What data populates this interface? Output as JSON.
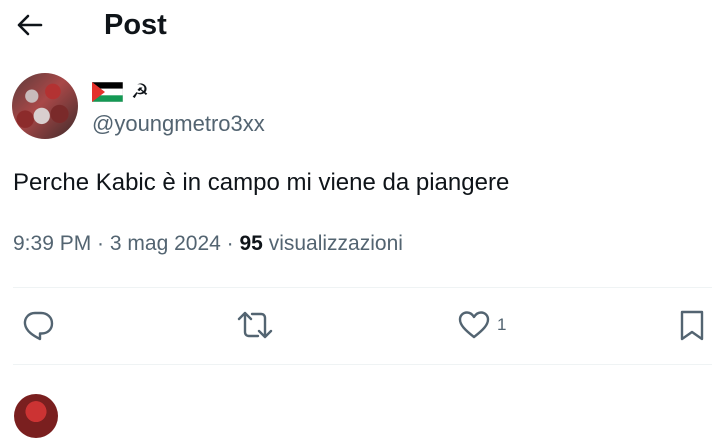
{
  "header": {
    "title": "Post",
    "back_icon": "arrow-left-icon"
  },
  "author": {
    "flag_icon": "palestine-flag-icon",
    "symbol": "☭",
    "handle": "@youngmetro3xx"
  },
  "post": {
    "text": "Perche Kabic è in campo mi viene da piangere",
    "time": "9:39 PM",
    "date": "3 mag 2024",
    "views_count": "95",
    "views_label": "visualizzazioni"
  },
  "actions": {
    "reply_icon": "reply-icon",
    "repost_icon": "repost-icon",
    "like_icon": "heart-icon",
    "like_count": "1",
    "bookmark_icon": "bookmark-icon"
  },
  "colors": {
    "text_primary": "#0f1419",
    "text_secondary": "#536471",
    "divider": "#eff3f4",
    "flag_red": "#e4312b",
    "flag_green": "#149954",
    "flag_black": "#000000"
  }
}
